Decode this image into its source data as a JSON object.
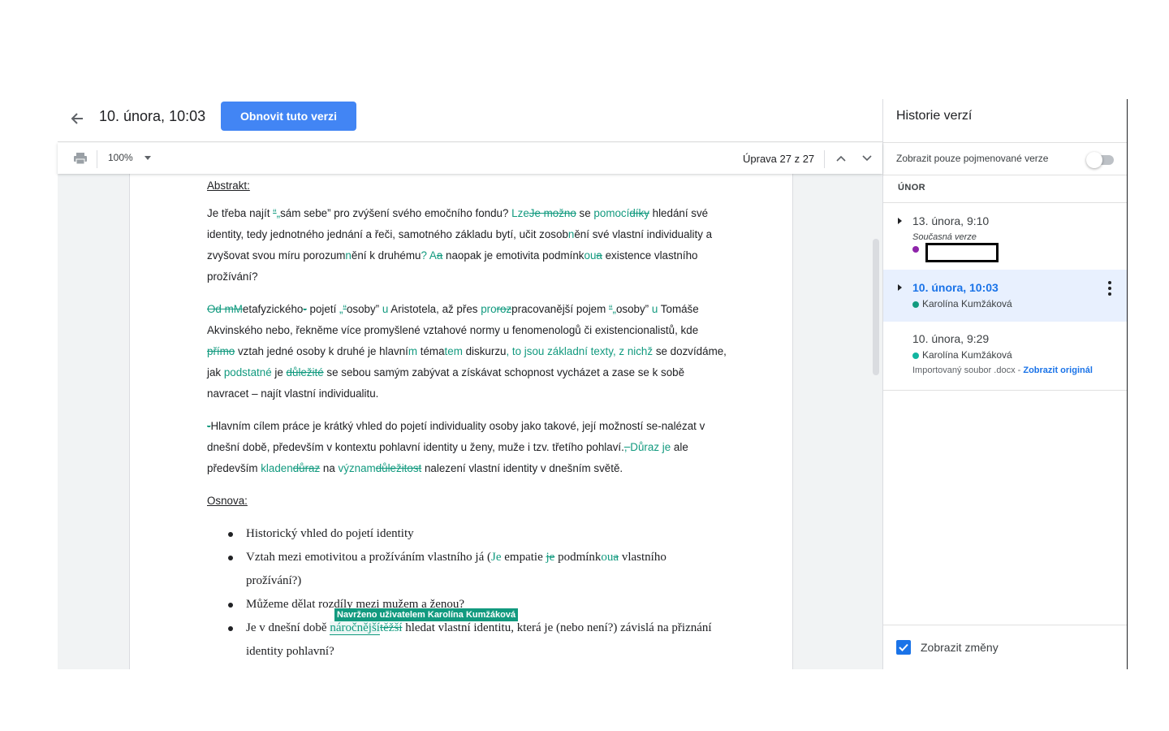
{
  "header": {
    "version_title": "10. února, 10:03",
    "restore_label": "Obnovit tuto verzi"
  },
  "toolbar": {
    "zoom": "100%",
    "edit_counter": "Úprava 27 z 27"
  },
  "document": {
    "abstract_heading": "Abstrakt:",
    "outline_heading": "Osnova:",
    "p1": [
      {
        "t": "Je třeba najít ",
        "k": "n"
      },
      {
        "t": "“",
        "k": "d"
      },
      {
        "t": "„",
        "k": "i"
      },
      {
        "t": "sám sebe” pro zvýšení svého emočního fondu? ",
        "k": "n"
      },
      {
        "t": "Lze",
        "k": "i"
      },
      {
        "t": "Je možno",
        "k": "d"
      },
      {
        "t": " se ",
        "k": "n"
      },
      {
        "t": "pomocí",
        "k": "i"
      },
      {
        "t": "díky",
        "k": "d"
      },
      {
        "t": " hledání své identity, tedy jednotného jednání a řeči, samotného základu bytí, učit zosob",
        "k": "n"
      },
      {
        "t": "n",
        "k": "i"
      },
      {
        "t": "ění své vlastní individuality a zvyšovat svou míru porozum",
        "k": "n"
      },
      {
        "t": "n",
        "k": "i"
      },
      {
        "t": "ění k druhému",
        "k": "n"
      },
      {
        "t": "? A",
        "k": "i"
      },
      {
        "t": "a",
        "k": "d"
      },
      {
        "t": " naopak je emotivita podmínk",
        "k": "n"
      },
      {
        "t": "ou",
        "k": "i"
      },
      {
        "t": "a",
        "k": "d"
      },
      {
        "t": " existence vlastního prožívání?",
        "k": "n"
      }
    ],
    "p2": [
      {
        "t": "Od mM",
        "k": "d"
      },
      {
        "t": "etafyzického",
        "k": "n"
      },
      {
        "t": "-",
        "k": "d"
      },
      {
        "t": " pojetí ",
        "k": "n"
      },
      {
        "t": "„",
        "k": "i"
      },
      {
        "t": "“",
        "k": "d"
      },
      {
        "t": "osoby” ",
        "k": "n"
      },
      {
        "t": "u",
        "k": "i"
      },
      {
        "t": " Aristotela, až přes ",
        "k": "n"
      },
      {
        "t": "pro",
        "k": "i"
      },
      {
        "t": "roz",
        "k": "d"
      },
      {
        "t": "pracovanější pojem ",
        "k": "n"
      },
      {
        "t": "“",
        "k": "d"
      },
      {
        "t": "„",
        "k": "i"
      },
      {
        "t": "osoby” ",
        "k": "n"
      },
      {
        "t": "u",
        "k": "i"
      },
      {
        "t": " Tomáše Akvinského nebo, řekněme více promyšlené vztahové normy u fenomenologů či existencionalistů, kde ",
        "k": "n"
      },
      {
        "t": "přímo",
        "k": "d"
      },
      {
        "t": " vztah jedné osoby k druhé je hlavní",
        "k": "n"
      },
      {
        "t": "m",
        "k": "i"
      },
      {
        "t": " téma",
        "k": "n"
      },
      {
        "t": "tem",
        "k": "i"
      },
      {
        "t": " diskurzu",
        "k": "n"
      },
      {
        "t": ", to jsou základní texty, z nichž",
        "k": "i"
      },
      {
        "t": " se dozvídáme, jak ",
        "k": "n"
      },
      {
        "t": "podstatné",
        "k": "i"
      },
      {
        "t": " je ",
        "k": "n"
      },
      {
        "t": "důležité",
        "k": "d"
      },
      {
        "t": " se sebou samým zabývat a získávat schopnost vycházet a zase se k sobě navracet – najít vlastní individualitu.",
        "k": "n"
      }
    ],
    "p3": [
      {
        "t": "-",
        "k": "d"
      },
      {
        "t": "Hlavním cílem práce je krátký vhled do pojetí individuality osoby jako takové, její možností se-nalézat v dnešní době, především v kontextu pohlavní identity u ženy, muže i tzv. třetího pohlaví.",
        "k": "n"
      },
      {
        "t": ", ",
        "k": "d"
      },
      {
        "t": "Důraz je",
        "k": "i"
      },
      {
        "t": " ale především ",
        "k": "n"
      },
      {
        "t": "kladen",
        "k": "i"
      },
      {
        "t": "důraz",
        "k": "d"
      },
      {
        "t": " na ",
        "k": "n"
      },
      {
        "t": "význam",
        "k": "i"
      },
      {
        "t": "důležitost",
        "k": "d"
      },
      {
        "t": " nalezení vlastní identity v dnešním světě.",
        "k": "n"
      }
    ],
    "bullets": [
      [
        {
          "t": "Historický vhled do pojetí identity",
          "k": "n"
        }
      ],
      [
        {
          "t": "Vztah mezi emotivitou a prožíváním vlastního já (",
          "k": "n"
        },
        {
          "t": "Je",
          "k": "i"
        },
        {
          "t": " empatie ",
          "k": "n"
        },
        {
          "t": "je",
          "k": "d"
        },
        {
          "t": " podmínk",
          "k": "n"
        },
        {
          "t": "ou",
          "k": "i"
        },
        {
          "t": "a",
          "k": "d"
        },
        {
          "t": " vlastního prožívání?)",
          "k": "n"
        }
      ],
      [
        {
          "t": "Můžeme dělat rozdíly mezi mužem a ženou?",
          "k": "n"
        }
      ],
      [
        {
          "t": "Je v dnešní době ",
          "k": "n"
        },
        {
          "t": "náročnější",
          "k": "ib"
        },
        {
          "t": "těžší",
          "k": "d"
        },
        {
          "t": " hledat vlastní identitu, která je (nebo není?) závislá na přiznání identity pohlavní?",
          "k": "n"
        }
      ]
    ],
    "suggestion_tooltip": "Navrženo uživatelem Karolína Kumžáková"
  },
  "side_panel": {
    "title": "Historie verzí",
    "named_only_label": "Zobrazit pouze pojmenované verze",
    "named_only_on": false,
    "month": "ÚNOR",
    "versions": [
      {
        "date": "13. února, 9:10",
        "sub": "Současná verze",
        "dot_color": "#8e24aa"
      },
      {
        "date": "10. února, 10:03",
        "author": "Karolína Kumžáková",
        "dot_color": "#129a7f",
        "selected": true
      },
      {
        "date": "10. února, 9:29",
        "author": "Karolína Kumžáková",
        "dot_color": "#12b5a0",
        "imported": "Importovaný soubor .docx - ",
        "orig_link": "Zobrazit originál"
      }
    ],
    "show_changes_label": "Zobrazit změny",
    "show_changes_checked": true
  },
  "colors": {
    "accent": "#4285f4",
    "suggestion": "#129a7f",
    "selected_bg": "#e8f0fe",
    "link": "#1a73e8"
  }
}
